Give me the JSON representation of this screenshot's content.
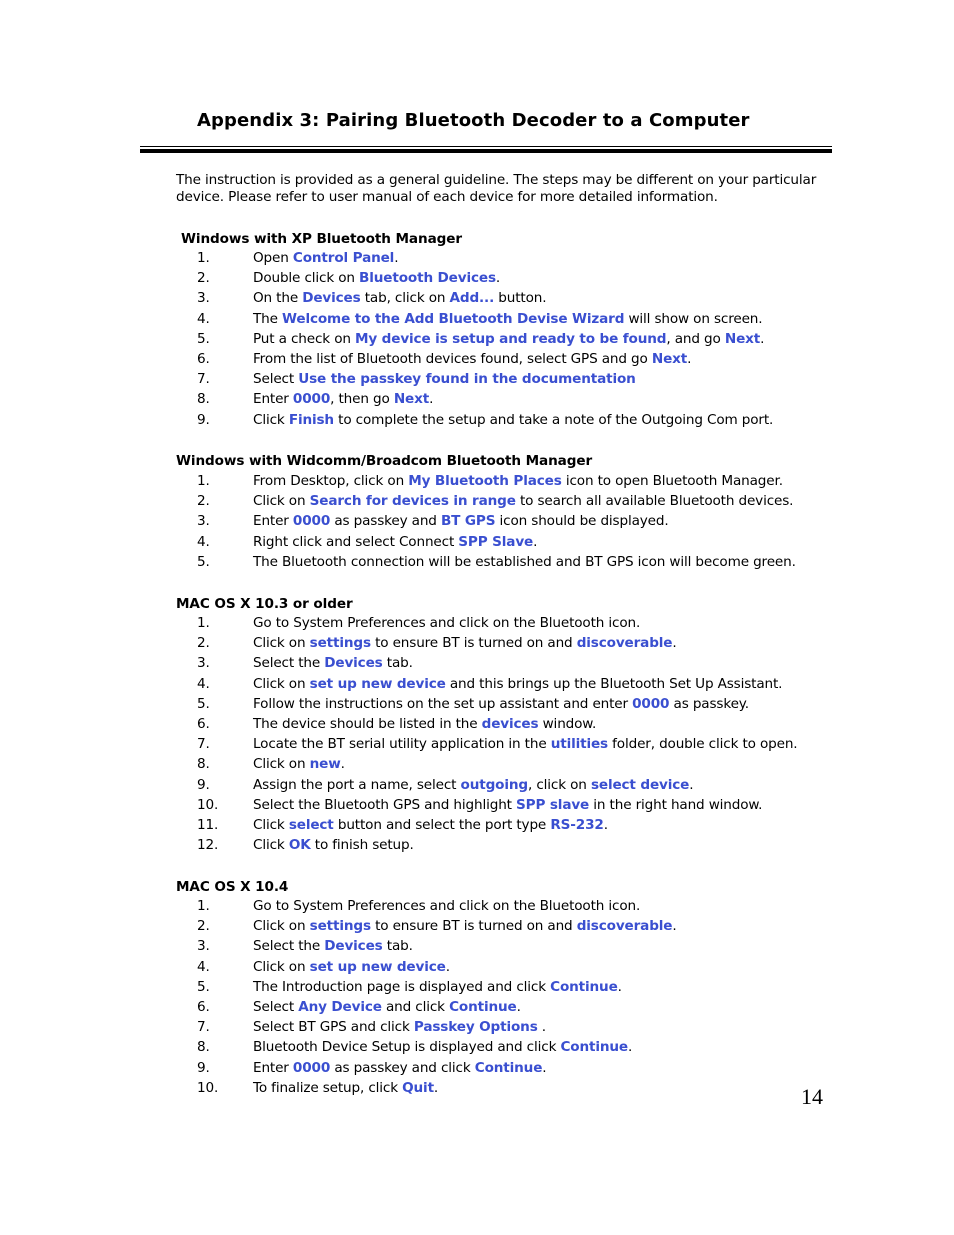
{
  "title": "Appendix 3: Pairing Bluetooth Decoder to a Computer",
  "intro": "The instruction is provided as a general guideline. The steps may be different on your particular device. Please refer to user manual of each device for more detailed information.",
  "highlight_color": "#3a4fd0",
  "sections": [
    {
      "heading": "Windows with XP Bluetooth Manager",
      "steps": [
        {
          "num": "1.",
          "parts": [
            {
              "t": "Open "
            },
            {
              "t": "Control Panel",
              "hl": true
            },
            {
              "t": "."
            }
          ]
        },
        {
          "num": "2.",
          "parts": [
            {
              "t": "Double click on "
            },
            {
              "t": "Bluetooth Devices",
              "hl": true
            },
            {
              "t": "."
            }
          ]
        },
        {
          "num": "3.",
          "parts": [
            {
              "t": "On the "
            },
            {
              "t": "Devices",
              "hl": true
            },
            {
              "t": " tab, click on "
            },
            {
              "t": "Add...",
              "hl": true
            },
            {
              "t": " button."
            }
          ]
        },
        {
          "num": "4.",
          "parts": [
            {
              "t": "The "
            },
            {
              "t": "Welcome to the Add Bluetooth Devise Wizard",
              "hl": true
            },
            {
              "t": " will show on screen."
            }
          ]
        },
        {
          "num": "5.",
          "parts": [
            {
              "t": "Put a check on "
            },
            {
              "t": "My device is setup and ready to be found",
              "hl": true
            },
            {
              "t": ", and go "
            },
            {
              "t": "Next",
              "hl": true
            },
            {
              "t": "."
            }
          ]
        },
        {
          "num": "6.",
          "parts": [
            {
              "t": "From the list of Bluetooth devices found, select GPS and go "
            },
            {
              "t": "Next",
              "hl": true
            },
            {
              "t": "."
            }
          ]
        },
        {
          "num": "7.",
          "parts": [
            {
              "t": "Select "
            },
            {
              "t": "Use the passkey found in the documentation",
              "hl": true
            }
          ]
        },
        {
          "num": "8.",
          "parts": [
            {
              "t": "Enter "
            },
            {
              "t": "0000",
              "hl": true
            },
            {
              "t": ", then go "
            },
            {
              "t": "Next",
              "hl": true
            },
            {
              "t": "."
            }
          ]
        },
        {
          "num": "9.",
          "parts": [
            {
              "t": "Click "
            },
            {
              "t": "Finish",
              "hl": true
            },
            {
              "t": " to complete the setup and take a note of the Outgoing Com port."
            }
          ]
        }
      ]
    },
    {
      "heading": "Windows with Widcomm/Broadcom Bluetooth Manager",
      "steps": [
        {
          "num": "1.",
          "parts": [
            {
              "t": "From Desktop, click on "
            },
            {
              "t": "My Bluetooth Places",
              "hl": true
            },
            {
              "t": " icon to open Bluetooth Manager."
            }
          ]
        },
        {
          "num": "2.",
          "parts": [
            {
              "t": "Click on "
            },
            {
              "t": "Search for devices in range",
              "hl": true
            },
            {
              "t": " to search all available Bluetooth devices."
            }
          ]
        },
        {
          "num": "3.",
          "parts": [
            {
              "t": "Enter "
            },
            {
              "t": "0000",
              "hl": true
            },
            {
              "t": " as passkey and "
            },
            {
              "t": "BT GPS",
              "hl": true
            },
            {
              "t": " icon should be displayed."
            }
          ]
        },
        {
          "num": "4.",
          "parts": [
            {
              "t": "Right click and select Connect "
            },
            {
              "t": "SPP Slave",
              "hl": true
            },
            {
              "t": "."
            }
          ]
        },
        {
          "num": "5.",
          "parts": [
            {
              "t": "The Bluetooth connection will be established and BT GPS icon will become green."
            }
          ]
        }
      ]
    },
    {
      "heading": "MAC OS X 10.3 or older",
      "steps": [
        {
          "num": "1.",
          "parts": [
            {
              "t": "Go to System Preferences and click on the Bluetooth icon."
            }
          ]
        },
        {
          "num": "2.",
          "parts": [
            {
              "t": "Click on "
            },
            {
              "t": "settings",
              "hl": true
            },
            {
              "t": " to ensure BT is turned on and "
            },
            {
              "t": "discoverable",
              "hl": true
            },
            {
              "t": "."
            }
          ]
        },
        {
          "num": "3.",
          "parts": [
            {
              "t": "Select the "
            },
            {
              "t": "Devices",
              "hl": true
            },
            {
              "t": " tab."
            }
          ]
        },
        {
          "num": "4.",
          "parts": [
            {
              "t": "Click on "
            },
            {
              "t": "set up new device",
              "hl": true
            },
            {
              "t": " and this brings up the Bluetooth Set Up Assistant."
            }
          ]
        },
        {
          "num": "5.",
          "parts": [
            {
              "t": "Follow the instructions on the set up assistant and enter "
            },
            {
              "t": "0000",
              "hl": true
            },
            {
              "t": " as passkey."
            }
          ]
        },
        {
          "num": "6.",
          "parts": [
            {
              "t": "The device should be listed in the "
            },
            {
              "t": "devices",
              "hl": true
            },
            {
              "t": " window."
            }
          ]
        },
        {
          "num": "7.",
          "parts": [
            {
              "t": "Locate the BT serial utility application in the "
            },
            {
              "t": "utilities",
              "hl": true
            },
            {
              "t": " folder, double click to open."
            }
          ]
        },
        {
          "num": "8.",
          "parts": [
            {
              "t": "Click on "
            },
            {
              "t": "new",
              "hl": true
            },
            {
              "t": "."
            }
          ]
        },
        {
          "num": "9.",
          "parts": [
            {
              "t": "Assign the port a name, select "
            },
            {
              "t": "outgoing",
              "hl": true
            },
            {
              "t": ", click on "
            },
            {
              "t": "select device",
              "hl": true
            },
            {
              "t": "."
            }
          ]
        },
        {
          "num": "10.",
          "parts": [
            {
              "t": "Select the Bluetooth GPS and highlight "
            },
            {
              "t": "SPP slave",
              "hl": true
            },
            {
              "t": " in the right hand window."
            }
          ]
        },
        {
          "num": "11.",
          "parts": [
            {
              "t": "Click "
            },
            {
              "t": "select",
              "hl": true
            },
            {
              "t": " button and select the port type "
            },
            {
              "t": "RS-232",
              "hl": true
            },
            {
              "t": "."
            }
          ]
        },
        {
          "num": "12.",
          "parts": [
            {
              "t": "Click "
            },
            {
              "t": "OK",
              "hl": true
            },
            {
              "t": " to finish setup."
            }
          ]
        }
      ]
    },
    {
      "heading": "MAC OS X 10.4",
      "steps": [
        {
          "num": "1.",
          "parts": [
            {
              "t": "Go to System Preferences and click on the Bluetooth icon."
            }
          ]
        },
        {
          "num": "2.",
          "parts": [
            {
              "t": "Click on "
            },
            {
              "t": "settings",
              "hl": true
            },
            {
              "t": " to ensure BT is turned on and "
            },
            {
              "t": "discoverable",
              "hl": true
            },
            {
              "t": "."
            }
          ]
        },
        {
          "num": "3.",
          "parts": [
            {
              "t": "Select the "
            },
            {
              "t": "Devices",
              "hl": true
            },
            {
              "t": " tab."
            }
          ]
        },
        {
          "num": "4.",
          "parts": [
            {
              "t": "Click on "
            },
            {
              "t": "set up new device",
              "hl": true
            },
            {
              "t": "."
            }
          ]
        },
        {
          "num": "5.",
          "parts": [
            {
              "t": "The Introduction page is displayed and click "
            },
            {
              "t": "Continue",
              "hl": true
            },
            {
              "t": "."
            }
          ]
        },
        {
          "num": "6.",
          "parts": [
            {
              "t": "Select "
            },
            {
              "t": "Any Device",
              "hl": true
            },
            {
              "t": " and click "
            },
            {
              "t": "Continue",
              "hl": true
            },
            {
              "t": "."
            }
          ]
        },
        {
          "num": "7.",
          "parts": [
            {
              "t": "Select BT GPS and click "
            },
            {
              "t": "Passkey Options",
              "hl": true
            },
            {
              "t": " ."
            }
          ]
        },
        {
          "num": "8.",
          "parts": [
            {
              "t": "Bluetooth Device Setup is displayed and click "
            },
            {
              "t": "Continue",
              "hl": true
            },
            {
              "t": "."
            }
          ]
        },
        {
          "num": "9.",
          "parts": [
            {
              "t": "Enter "
            },
            {
              "t": "0000",
              "hl": true
            },
            {
              "t": " as passkey and click "
            },
            {
              "t": "Continue",
              "hl": true
            },
            {
              "t": "."
            }
          ]
        },
        {
          "num": "10.",
          "parts": [
            {
              "t": "To finalize setup, click "
            },
            {
              "t": "Quit",
              "hl": true
            },
            {
              "t": "."
            }
          ]
        }
      ]
    }
  ],
  "page_number": "14"
}
